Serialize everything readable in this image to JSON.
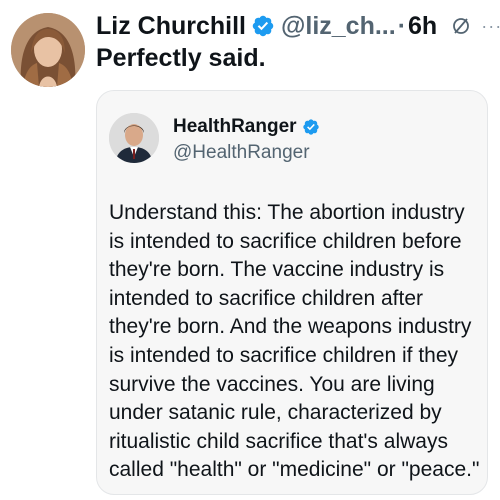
{
  "tweet": {
    "author_name": "Liz Churchill",
    "handle": "@liz_ch...",
    "separator": "·",
    "time": "6h",
    "text": "Perfectly said.",
    "more_label": "···"
  },
  "quoted": {
    "author_name": "HealthRanger",
    "handle": "@HealthRanger",
    "lines": [
      "Understand this: The abortion industry",
      "is intended to sacrifice children before",
      "they're born. The vaccine industry is",
      "intended to sacrifice children after",
      "they're born. And the weapons industry",
      "is intended to sacrifice children if they",
      "survive the vaccines. You are living",
      "under satanic rule, characterized by",
      "ritualistic child sacrifice that's always",
      "called \"health\" or \"medicine\" or \"peace.\""
    ]
  },
  "icons": {
    "verified": "verified-badge-icon",
    "grok": "grok-icon",
    "more": "more-icon"
  },
  "colors": {
    "verified_blue": "#1d9bf0",
    "text_primary": "#0f1419",
    "text_secondary": "#536471",
    "quote_background": "#f7f7f7"
  }
}
